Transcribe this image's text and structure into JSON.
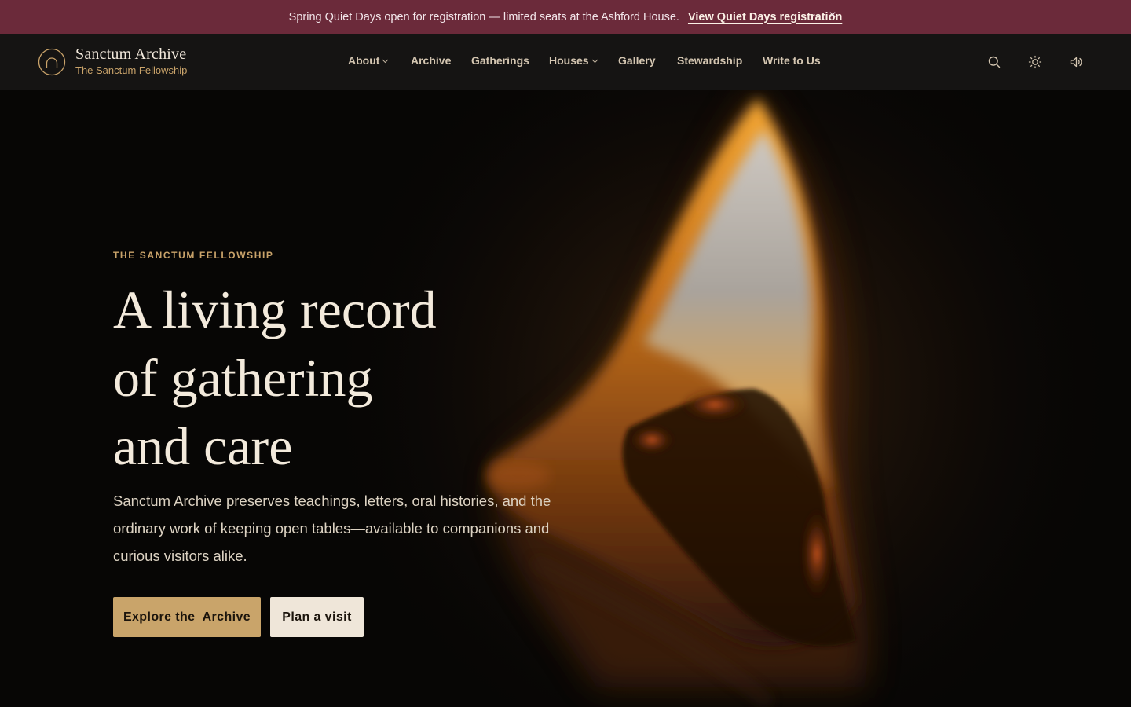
{
  "banner": {
    "message": "Spring Quiet Days open for registration — limited seats at the Ashford House.",
    "link_label": "View Quiet Days registration",
    "close_label": "×"
  },
  "brand": {
    "title": "Sanctum Archive",
    "subtitle": "The Sanctum Fellowship"
  },
  "nav": {
    "items": [
      {
        "label": "About",
        "has_dropdown": true
      },
      {
        "label": "Archive",
        "has_dropdown": false
      },
      {
        "label": "Gatherings",
        "has_dropdown": false
      },
      {
        "label": "Houses",
        "has_dropdown": true
      },
      {
        "label": "Gallery",
        "has_dropdown": false
      },
      {
        "label": "Stewardship",
        "has_dropdown": false
      },
      {
        "label": "Write to Us",
        "has_dropdown": false
      }
    ]
  },
  "header_icons": [
    "search-icon",
    "sun-icon",
    "speaker-icon"
  ],
  "hero": {
    "eyebrow": "THE SANCTUM FELLOWSHIP",
    "headline_lines": [
      "A living record",
      "of gathering",
      "and care"
    ],
    "lede": "Sanctum Archive preserves teachings, letters, oral histories, and the ordinary work of keeping open tables—available to companions and curious visitors alike.",
    "primary_cta": "Explore the  Archive",
    "secondary_cta": "Plan a visit"
  },
  "colors": {
    "banner_bg": "#6b2a3a",
    "header_bg": "#151413",
    "accent_gold": "#c9a46a",
    "cream": "#efe6d9",
    "hero_bg": "#070605"
  }
}
